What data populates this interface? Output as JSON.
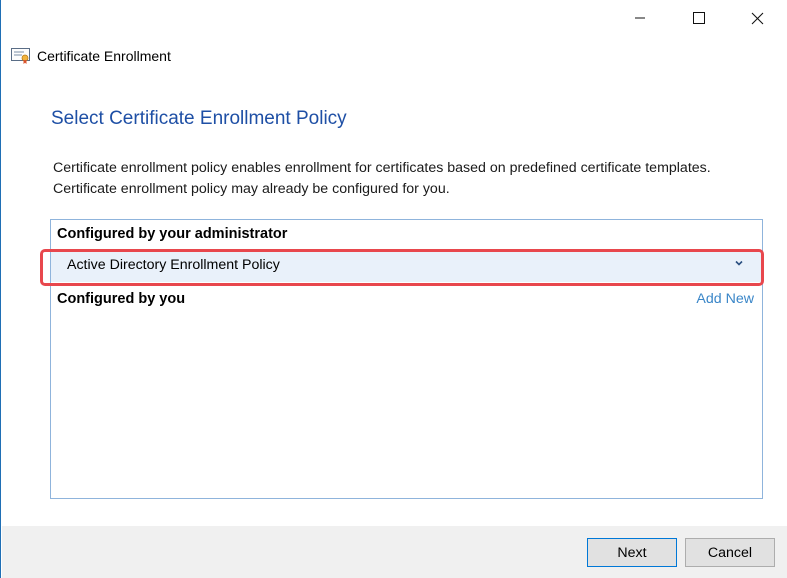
{
  "window": {
    "title": "Certificate Enrollment",
    "controls": {
      "minimize": "minimize-icon",
      "maximize": "maximize-icon",
      "close": "close-icon"
    }
  },
  "page": {
    "heading": "Select Certificate Enrollment Policy",
    "description_lines": [
      "Certificate enrollment policy enables enrollment for certificates based on predefined certificate templates.",
      "Certificate enrollment policy may already be configured for you."
    ]
  },
  "policies": {
    "admin_section_label": "Configured by your administrator",
    "admin_items": [
      {
        "label": "Active Directory Enrollment Policy",
        "expander_icon": "chevron-down-icon"
      }
    ],
    "user_section_label": "Configured by you",
    "add_new_label": "Add New"
  },
  "footer": {
    "next_label": "Next",
    "cancel_label": "Cancel"
  },
  "colors": {
    "heading": "#1e4fa5",
    "link": "#3a86c8",
    "highlight": "#e8474d",
    "selected_row": "#e9f1fa",
    "panel_border": "#8fb4dc"
  }
}
